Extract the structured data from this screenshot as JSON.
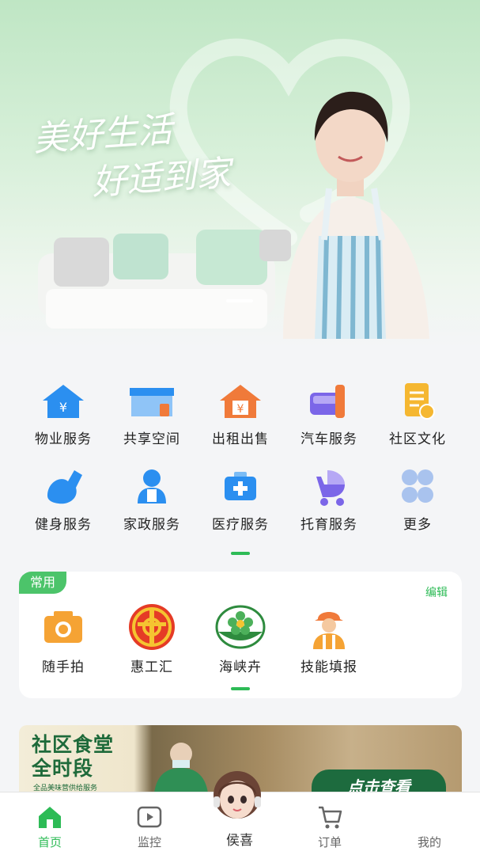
{
  "banner": {
    "slogan_line1": "美好生活",
    "slogan_line2": "好适到家"
  },
  "services": [
    {
      "label": "物业服务",
      "icon": "property-house-icon"
    },
    {
      "label": "共享空间",
      "icon": "shared-space-icon"
    },
    {
      "label": "出租出售",
      "icon": "rent-sale-house-icon"
    },
    {
      "label": "汽车服务",
      "icon": "car-wrench-icon"
    },
    {
      "label": "社区文化",
      "icon": "document-check-icon"
    },
    {
      "label": "健身服务",
      "icon": "muscle-arm-icon"
    },
    {
      "label": "家政服务",
      "icon": "housekeeper-icon"
    },
    {
      "label": "医疗服务",
      "icon": "medical-kit-icon"
    },
    {
      "label": "托育服务",
      "icon": "baby-stroller-icon"
    },
    {
      "label": "更多",
      "icon": "more-grid-icon"
    }
  ],
  "common": {
    "tag": "常用",
    "edit_label": "编辑",
    "items": [
      {
        "label": "随手拍",
        "icon": "camera-icon"
      },
      {
        "label": "惠工汇",
        "icon": "union-badge-icon"
      },
      {
        "label": "海峡卉",
        "icon": "flower-badge-icon"
      },
      {
        "label": "技能填报",
        "icon": "worker-helmet-icon"
      }
    ]
  },
  "ad": {
    "title_line1": "社区食堂",
    "title_line2": "全时段",
    "subtitle": "全品美味营供给服务",
    "cta": "点击查看"
  },
  "nav": {
    "items": [
      {
        "label": "首页",
        "icon": "home-icon"
      },
      {
        "label": "监控",
        "icon": "video-play-icon"
      },
      {
        "label": "侯喜",
        "icon": "assistant-avatar-icon"
      },
      {
        "label": "订单",
        "icon": "cart-icon"
      },
      {
        "label": "我的",
        "icon": "profile-icon"
      }
    ]
  },
  "colors": {
    "brand_green": "#2dbb56",
    "tag_green": "#4cc46a",
    "icon_blue": "#2b8ff0",
    "icon_orange": "#f07a3a",
    "icon_purple": "#7b66e8"
  }
}
